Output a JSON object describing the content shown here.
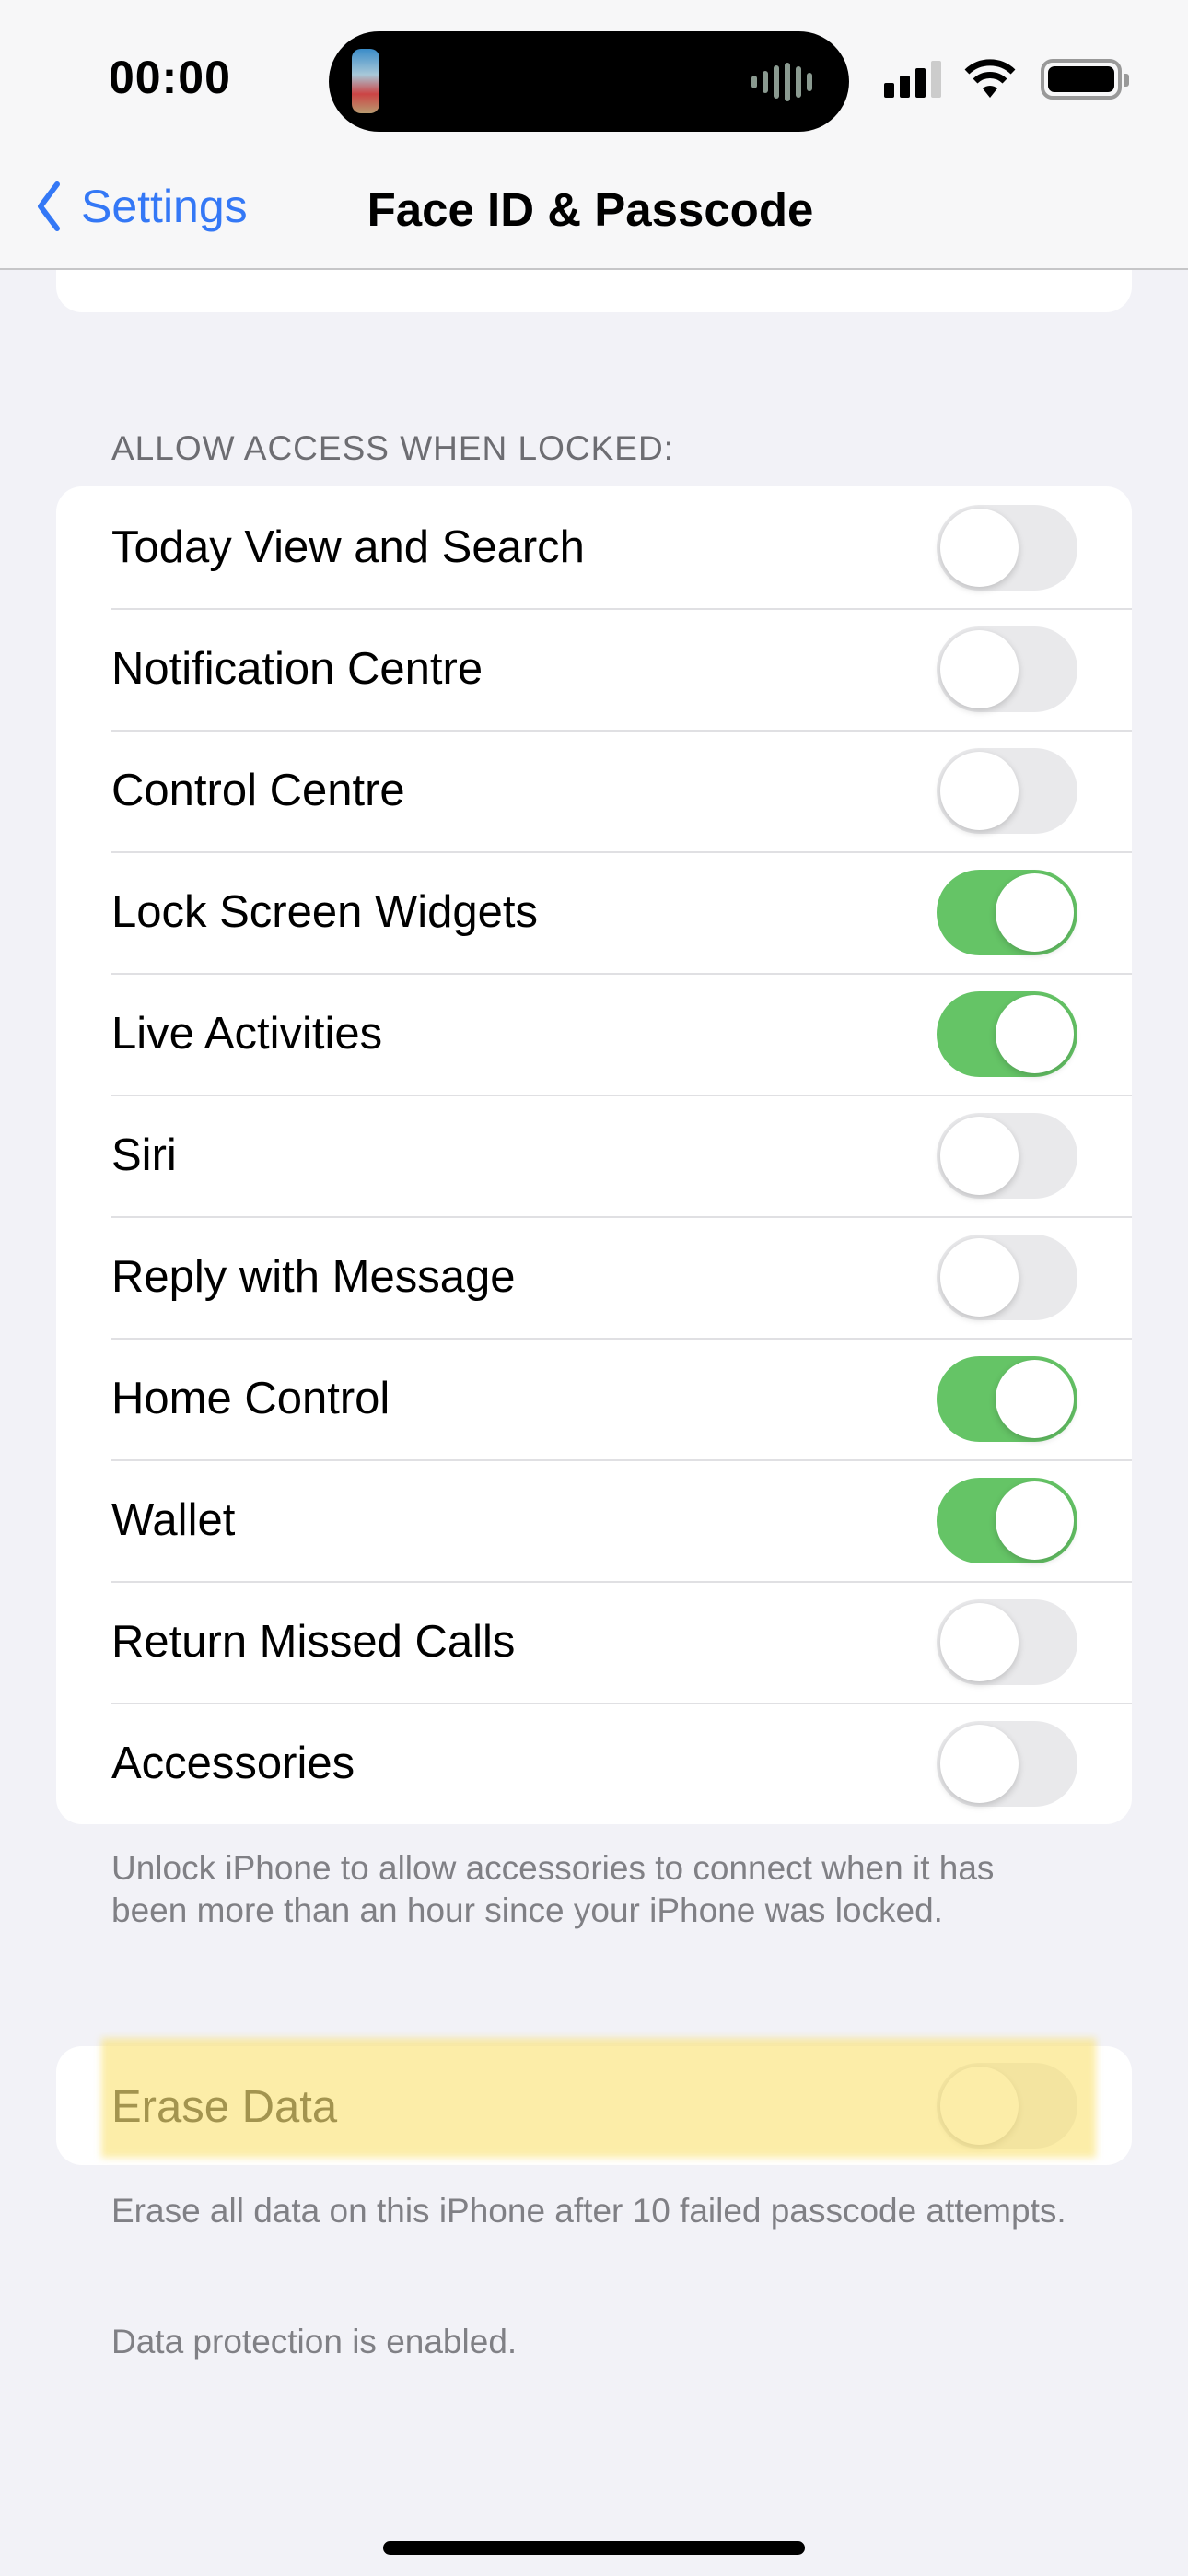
{
  "status_bar": {
    "time": "00:00"
  },
  "nav": {
    "back_label": "Settings",
    "title": "Face ID & Passcode"
  },
  "allow_access": {
    "header": "ALLOW ACCESS WHEN LOCKED:",
    "items": [
      {
        "label": "Today View and Search",
        "on": false
      },
      {
        "label": "Notification Centre",
        "on": false
      },
      {
        "label": "Control Centre",
        "on": false
      },
      {
        "label": "Lock Screen Widgets",
        "on": true
      },
      {
        "label": "Live Activities",
        "on": true
      },
      {
        "label": "Siri",
        "on": false
      },
      {
        "label": "Reply with Message",
        "on": false
      },
      {
        "label": "Home Control",
        "on": true
      },
      {
        "label": "Wallet",
        "on": true
      },
      {
        "label": "Return Missed Calls",
        "on": false
      },
      {
        "label": "Accessories",
        "on": false
      }
    ],
    "footer": "Unlock iPhone to allow accessories to connect when it has been more than an hour since your iPhone was locked."
  },
  "erase": {
    "label": "Erase Data",
    "on": false,
    "highlighted": true,
    "footer": "Erase all data on this iPhone after 10 failed passcode attempts.",
    "note": "Data protection is enabled."
  },
  "colors": {
    "accent": "#3478f6",
    "toggle_on": "#65c466",
    "highlight": "#fae16e"
  }
}
